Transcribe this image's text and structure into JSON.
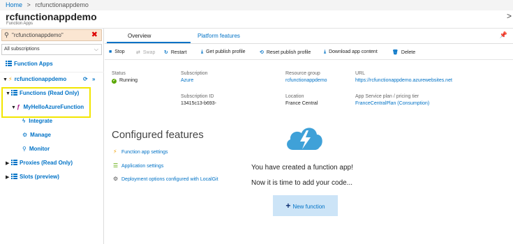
{
  "breadcrumb": {
    "home": "Home",
    "sep": ">",
    "current": "rcfunctionappdemo"
  },
  "header": {
    "title": "rcfunctionappdemo",
    "subtitle": "Function Apps",
    "collapse": ">"
  },
  "sidebar": {
    "search_value": "\"rcfunctionappdemo\"",
    "subscriptions": "All subscriptions",
    "function_apps": "Function Apps",
    "app_name": "rcfunctionappdemo",
    "functions": "Functions (Read Only)",
    "function_name": "MyHelloAzureFunction",
    "integrate": "Integrate",
    "manage": "Manage",
    "monitor": "Monitor",
    "proxies": "Proxies (Read Only)",
    "slots": "Slots (preview)"
  },
  "tabs": {
    "overview": "Overview",
    "platform": "Platform features"
  },
  "toolbar": {
    "stop": "Stop",
    "swap": "Swap",
    "restart": "Restart",
    "get_profile": "Get publish profile",
    "reset_profile": "Reset publish profile",
    "download": "Download app content",
    "delete": "Delete"
  },
  "overview": {
    "status_label": "Status",
    "status_value": "Running",
    "subscription_label": "Subscription",
    "subscription_value": "Azure",
    "subscription_id_label": "Subscription ID",
    "subscription_id_value": "13415c13-b693-",
    "resource_group_label": "Resource group",
    "resource_group_value": "rcfunctionappdemo",
    "location_label": "Location",
    "location_value": "France Central",
    "url_label": "URL",
    "url_value": "https://rcfunctionappdemo.azurewebsites.net",
    "plan_label": "App Service plan / pricing tier",
    "plan_value": "FranceCentralPlan (Consumption)"
  },
  "configured": {
    "title": "Configured features",
    "items": [
      "Function app settings",
      "Application settings",
      "Deployment options configured with LocalGit"
    ]
  },
  "empty_state": {
    "line1": "You have created a function app!",
    "line2": "Now it is time to add your code...",
    "button": "New function"
  },
  "colors": {
    "accent": "#0072c6",
    "highlight": "#f2e600",
    "cloud": "#3fa1d8"
  }
}
